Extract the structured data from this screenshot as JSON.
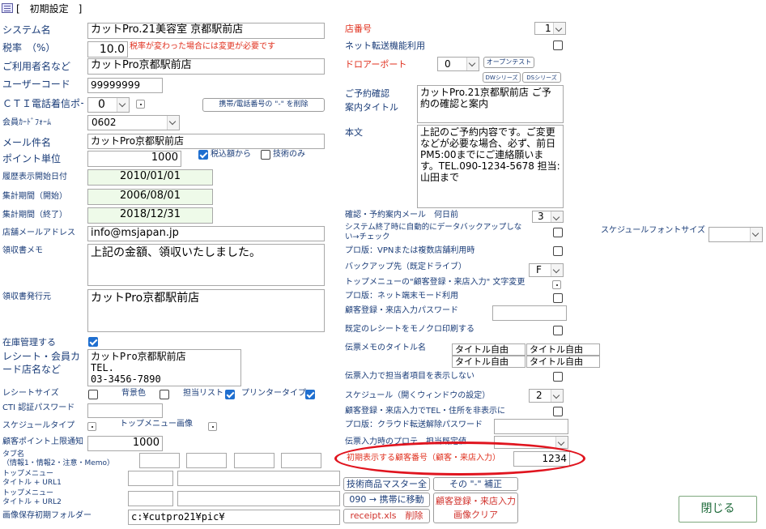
{
  "window": {
    "title": "[　初期設定　]"
  },
  "left": {
    "system_name": {
      "label": "システム名",
      "value": "カットPro.21美容室  京都駅前店"
    },
    "tax_rate": {
      "label": "税率　（%）",
      "value": "10.0",
      "note": "税率が変わった場合には変更が必要です"
    },
    "user_name": {
      "label": "ご利用者名など",
      "value": "カットPro京都駅前店"
    },
    "user_code": {
      "label": "ユーザーコード",
      "value": "99999999"
    },
    "cti_port": {
      "label": "ＣＴＩ電話着信ポート",
      "value": "0"
    },
    "phone_delete_button": "携帯/電話番号の \"-\" を削除",
    "member_card_form": {
      "label": "会員ｶｰﾄﾞﾌｫｰﾑ",
      "value": "0602"
    },
    "mail_subject": {
      "label": "メール件名",
      "value": "カットPro京都駅前店"
    },
    "point_unit": {
      "label": "ポイント単位",
      "value": "1000",
      "tax_incl": "税込額から",
      "tech_only": "技術のみ"
    },
    "history_start": {
      "label": "履歴表示開始日付",
      "value": "2010/01/01"
    },
    "period_start": {
      "label": "集計期間（開始）",
      "value": "2006/08/01"
    },
    "period_end": {
      "label": "集計期間（終了）",
      "value": "2018/12/31"
    },
    "shop_mail": {
      "label": "店舗メールアドレス",
      "value": "info@msjapan.jp"
    },
    "receipt_memo": {
      "label": "領収書メモ",
      "value": "上記の金額、領収いたしました。"
    },
    "receipt_issuer": {
      "label": "領収書発行元",
      "value": "カットPro京都駅前店"
    },
    "inventory": {
      "label": "在庫管理する"
    },
    "receipt_store_name": {
      "label": "レシート・会員カード店名など",
      "value": "カットPro京都駅前店\nTEL.\n03-3456-7890"
    },
    "receipt_size": {
      "label": "レシートサイズ",
      "back_color": "背景色",
      "staff_list": "担当リスト",
      "printer_type": "プリンタータイプ"
    },
    "cti_password": {
      "label": "CTI 認証パスワード"
    },
    "schedule_type": {
      "label": "スケジュールタイプ",
      "top_menu_image": "トップメニュー画像"
    },
    "point_limit": {
      "label": "顧客ポイント上限通知",
      "value": "1000"
    },
    "tab_names": {
      "label": "タブ名\n（情報1・情報2・注意・Memo）"
    },
    "top_menu1": {
      "label": "トップメニュー\nタイトル + URL1"
    },
    "top_menu2": {
      "label": "トップメニュー\nタイトル + URL2"
    },
    "image_folder": {
      "label": "画像保存初期フォルダー",
      "value": "c:¥cutpro21¥pic¥"
    }
  },
  "right": {
    "store_no": {
      "label": "店番号",
      "value": "1"
    },
    "net_transfer": {
      "label": "ネット転送機能利用"
    },
    "drawer_port": {
      "label": "ドロアーポート",
      "value": "0",
      "test_button": "オープンテスト",
      "dw_button": "DWシリーズ",
      "ds_button": "DSシリーズ"
    },
    "reserve_title": {
      "label": "ご予約確認\n案内タイトル",
      "value": "カットPro.21京都駅前店 ご予約の確認と案内"
    },
    "body": {
      "label": "本文",
      "value": "上記のご予約内容です。ご変更などが必要な場合、必ず、前日PM5:00までにご連絡願います。TEL.090-1234-5678 担当:山田まで"
    },
    "confirm_days": {
      "label": "確認・予約案内メール　何日前",
      "value": "3"
    },
    "auto_backup": {
      "label": "システム終了時に自動的にデータバックアップしない→チェック"
    },
    "schedule_font": {
      "label": "スケジュールフォントサイズ"
    },
    "pro_vpn": {
      "label": "プロ版：VPNまたは複数店舗利用時"
    },
    "backup_drive": {
      "label": "バックアップ先（既定ドライブ）",
      "value": "F"
    },
    "top_menu_text": {
      "label": "トップメニューの\"顧客登録・来店入力\" 文字変更"
    },
    "pro_net_terminal": {
      "label": "プロ版：ネット端末モード利用"
    },
    "customer_password": {
      "label": "顧客登録・来店入力パスワード"
    },
    "mono_receipt": {
      "label": "既定のレシートをモノクロ印刷する"
    },
    "slip_memo_titles": {
      "label": "伝票メモのタイトル名",
      "items": [
        "タイトル自由",
        "タイトル自由",
        "タイトル自由",
        "タイトル自由"
      ]
    },
    "show_staff": {
      "label": "伝票入力で担当者項目を表示しない"
    },
    "schedule_window": {
      "label": "スケジュール（開くウィンドウの設定）",
      "value": "2"
    },
    "hide_tel": {
      "label": "顧客登録・来店入力でTEL・住所を非表示に"
    },
    "cloud_password": {
      "label": "プロ版：クラウド転送解除パスワード"
    },
    "slip_input": {
      "label": "伝票入力時のプロテ…担当既定値"
    },
    "initial_customer_no": {
      "label": "初期表示する顧客番号（顧客・来店入力）",
      "value": "1234"
    },
    "btn_tech_master": "技術商品マスター全",
    "btn_hyphen_fix": "その \"-\" 補正",
    "btn_mobile_move": "090 → 携帯に移動",
    "btn_receipt_delete": "receipt.xls　削除",
    "btn_image_clear": "顧客登録・来店入力\n画像クリア",
    "btn_close": "閉じる"
  },
  "colors": {
    "label": "#1a3c78",
    "accent_red": "#e0141e",
    "date_bg": "#eefae9",
    "close_text": "#1e6a3a"
  }
}
